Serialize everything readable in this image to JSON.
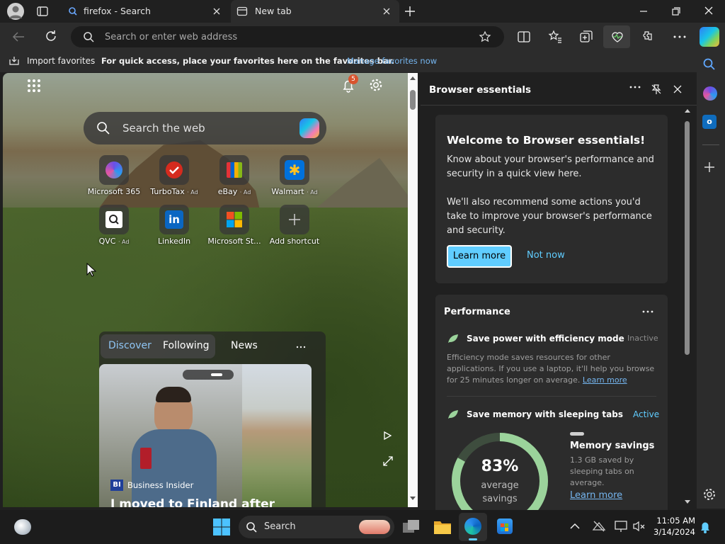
{
  "tabs": [
    {
      "label": "firefox - Search"
    },
    {
      "label": "New tab"
    }
  ],
  "toolbar": {
    "address_placeholder": "Search or enter web address"
  },
  "favbar": {
    "import_label": "Import favorites",
    "hint": "For quick access, place your favorites here on the favorites bar.",
    "manage_link": "Manage favorites now"
  },
  "newtab": {
    "notification_count": "5",
    "search_placeholder": "Search the web",
    "shortcuts": [
      {
        "name": "Microsoft 365",
        "ad": ""
      },
      {
        "name": "TurboTax",
        "ad": "· Ad"
      },
      {
        "name": "eBay",
        "ad": "· Ad"
      },
      {
        "name": "Walmart",
        "ad": "· Ad"
      },
      {
        "name": "QVC",
        "ad": "· Ad"
      },
      {
        "name": "LinkedIn",
        "ad": ""
      },
      {
        "name": "Microsoft St...",
        "ad": ""
      },
      {
        "name": "Add shortcut",
        "ad": ""
      }
    ],
    "feed": {
      "tabs": [
        "Discover",
        "Following",
        "News"
      ],
      "card_source": "Business Insider",
      "card_badge": "BI",
      "card_headline": "I moved to Finland after"
    }
  },
  "essentials": {
    "title": "Browser essentials",
    "welcome": {
      "title": "Welcome to Browser essentials!",
      "p1": "Know about your browser's performance and security in a quick view here.",
      "p2": "We'll also recommend some actions you'd take to improve your browser's performance and security.",
      "learn_more": "Learn more",
      "not_now": "Not now"
    },
    "performance": {
      "title": "Performance",
      "efficiency_title": "Save power with efficiency mode",
      "efficiency_status": "Inactive",
      "efficiency_desc": "Efficiency mode saves resources for other applications. If you use a laptop, it'll help you browse for 25 minutes longer on average.",
      "efficiency_link": "Learn more",
      "sleeping_title": "Save memory with sleeping tabs",
      "sleeping_status": "Active",
      "percent": "83%",
      "percent_value": 0.83,
      "avg_label": "average savings",
      "mem_title": "Memory savings",
      "mem_desc": "1.3 GB saved by sleeping tabs on average.",
      "mem_link": "Learn more"
    }
  },
  "taskbar": {
    "search_label": "Search",
    "time": "11:05 AM",
    "date": "3/14/2024"
  },
  "colors": {
    "accent": "#60cdff",
    "green": "#9bd39b",
    "link": "#75b6f0"
  }
}
